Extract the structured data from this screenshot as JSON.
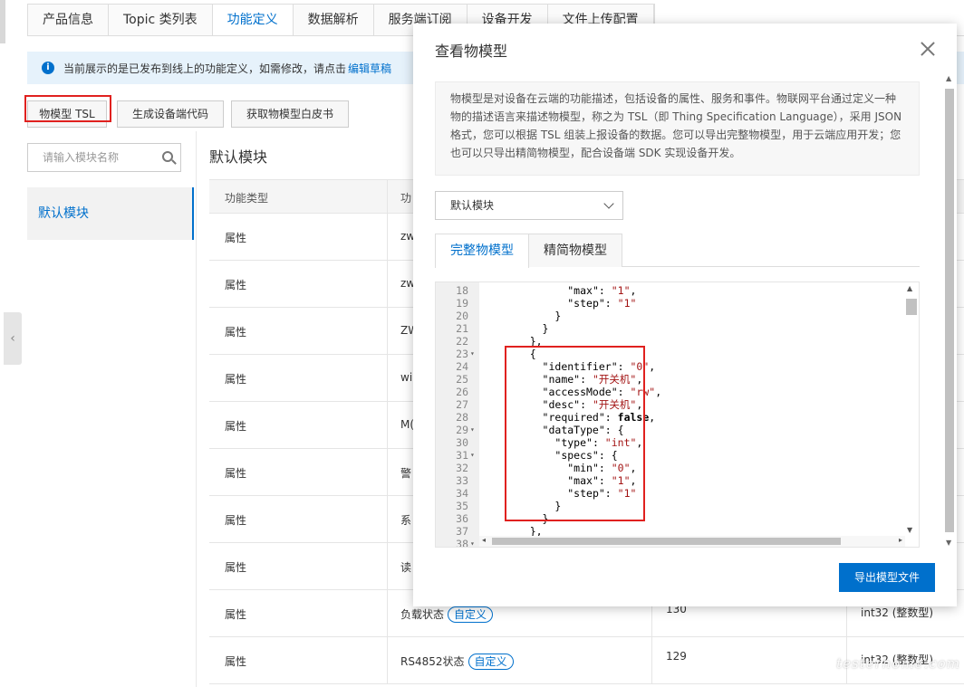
{
  "page": {
    "tabs": [
      "产品信息",
      "Topic 类列表",
      "功能定义",
      "数据解析",
      "服务端订阅",
      "设备开发",
      "文件上传配置"
    ],
    "active_tab": "功能定义",
    "notice_text": "当前展示的是已发布到线上的功能定义，如需修改，请点击",
    "notice_link": "编辑草稿",
    "buttons": {
      "tsl": "物模型 TSL",
      "gen_code": "生成设备端代码",
      "whitepaper": "获取物模型白皮书"
    },
    "search_placeholder": "请输入模块名称",
    "sidebar_module": "默认模块",
    "module_title": "默认模块",
    "table": {
      "headers": [
        "功能类型",
        "功"
      ],
      "rows": [
        {
          "type": "属性",
          "name": "zw",
          "tag": "",
          "id": "",
          "datatype": ""
        },
        {
          "type": "属性",
          "name": "zw",
          "tag": "",
          "id": "",
          "datatype": ""
        },
        {
          "type": "属性",
          "name": "ZW",
          "tag": "",
          "id": "",
          "datatype": ""
        },
        {
          "type": "属性",
          "name": "wi",
          "tag": "",
          "id": "",
          "datatype": ""
        },
        {
          "type": "属性",
          "name": "M(",
          "tag": "",
          "id": "",
          "datatype": ""
        },
        {
          "type": "属性",
          "name": "警",
          "tag": "",
          "id": "",
          "datatype": ""
        },
        {
          "type": "属性",
          "name": "系",
          "tag": "",
          "id": "",
          "datatype": ""
        },
        {
          "type": "属性",
          "name": "读",
          "tag": "",
          "id": "",
          "datatype": ""
        },
        {
          "type": "属性",
          "name": "负载状态",
          "tag": "自定义",
          "id": "130",
          "datatype": "int32 (整数型)"
        },
        {
          "type": "属性",
          "name": "RS4852状态",
          "tag": "自定义",
          "id": "129",
          "datatype": "int32 (整数型)"
        }
      ]
    }
  },
  "modal": {
    "title": "查看物模型",
    "description": "物模型是对设备在云端的功能描述，包括设备的属性、服务和事件。物联网平台通过定义一种物的描述语言来描述物模型，称之为 TSL（即 Thing Specification Language），采用 JSON 格式，您可以根据 TSL 组装上报设备的数据。您可以导出完整物模型，用于云端应用开发；您也可以只导出精简物模型，配合设备端 SDK 实现设备开发。",
    "module_select": "默认模块",
    "tabs": [
      "完整物模型",
      "精简物模型"
    ],
    "active_tab": "完整物模型",
    "export_button": "导出模型文件",
    "code_lines": [
      {
        "n": "18",
        "fold": "",
        "segs": [
          [
            "t",
            "          "
          ],
          [
            "k",
            "\"max\""
          ],
          [
            "t",
            ": "
          ],
          [
            "s",
            "\"1\""
          ],
          [
            "t",
            ","
          ]
        ]
      },
      {
        "n": "19",
        "fold": "",
        "segs": [
          [
            "t",
            "          "
          ],
          [
            "k",
            "\"step\""
          ],
          [
            "t",
            ": "
          ],
          [
            "s",
            "\"1\""
          ]
        ]
      },
      {
        "n": "20",
        "fold": "",
        "segs": [
          [
            "t",
            "        }"
          ]
        ]
      },
      {
        "n": "21",
        "fold": "",
        "segs": [
          [
            "t",
            "      }"
          ]
        ]
      },
      {
        "n": "22",
        "fold": "",
        "segs": [
          [
            "t",
            "    },"
          ]
        ]
      },
      {
        "n": "23",
        "fold": "▾",
        "segs": [
          [
            "t",
            "    {"
          ]
        ]
      },
      {
        "n": "24",
        "fold": "",
        "segs": [
          [
            "t",
            "      "
          ],
          [
            "k",
            "\"identifier\""
          ],
          [
            "t",
            ": "
          ],
          [
            "s",
            "\"0\""
          ],
          [
            "t",
            ","
          ]
        ]
      },
      {
        "n": "25",
        "fold": "",
        "segs": [
          [
            "t",
            "      "
          ],
          [
            "k",
            "\"name\""
          ],
          [
            "t",
            ": "
          ],
          [
            "s",
            "\"开关机\""
          ],
          [
            "t",
            ","
          ]
        ]
      },
      {
        "n": "26",
        "fold": "",
        "segs": [
          [
            "t",
            "      "
          ],
          [
            "k",
            "\"accessMode\""
          ],
          [
            "t",
            ": "
          ],
          [
            "s",
            "\"rw\""
          ],
          [
            "t",
            ","
          ]
        ]
      },
      {
        "n": "27",
        "fold": "",
        "segs": [
          [
            "t",
            "      "
          ],
          [
            "k",
            "\"desc\""
          ],
          [
            "t",
            ": "
          ],
          [
            "s",
            "\"开关机\""
          ],
          [
            "t",
            ","
          ]
        ]
      },
      {
        "n": "28",
        "fold": "",
        "segs": [
          [
            "t",
            "      "
          ],
          [
            "k",
            "\"required\""
          ],
          [
            "t",
            ": "
          ],
          [
            "b",
            "false"
          ],
          [
            "t",
            ","
          ]
        ]
      },
      {
        "n": "29",
        "fold": "▾",
        "segs": [
          [
            "t",
            "      "
          ],
          [
            "k",
            "\"dataType\""
          ],
          [
            "t",
            ": {"
          ]
        ]
      },
      {
        "n": "30",
        "fold": "",
        "segs": [
          [
            "t",
            "        "
          ],
          [
            "k",
            "\"type\""
          ],
          [
            "t",
            ": "
          ],
          [
            "s",
            "\"int\""
          ],
          [
            "t",
            ","
          ]
        ]
      },
      {
        "n": "31",
        "fold": "▾",
        "segs": [
          [
            "t",
            "        "
          ],
          [
            "k",
            "\"specs\""
          ],
          [
            "t",
            ": {"
          ]
        ]
      },
      {
        "n": "32",
        "fold": "",
        "segs": [
          [
            "t",
            "          "
          ],
          [
            "k",
            "\"min\""
          ],
          [
            "t",
            ": "
          ],
          [
            "s",
            "\"0\""
          ],
          [
            "t",
            ","
          ]
        ]
      },
      {
        "n": "33",
        "fold": "",
        "segs": [
          [
            "t",
            "          "
          ],
          [
            "k",
            "\"max\""
          ],
          [
            "t",
            ": "
          ],
          [
            "s",
            "\"1\""
          ],
          [
            "t",
            ","
          ]
        ]
      },
      {
        "n": "34",
        "fold": "",
        "segs": [
          [
            "t",
            "          "
          ],
          [
            "k",
            "\"step\""
          ],
          [
            "t",
            ": "
          ],
          [
            "s",
            "\"1\""
          ]
        ]
      },
      {
        "n": "35",
        "fold": "",
        "segs": [
          [
            "t",
            "        }"
          ]
        ]
      },
      {
        "n": "36",
        "fold": "",
        "segs": [
          [
            "t",
            "      }"
          ]
        ]
      },
      {
        "n": "37",
        "fold": "",
        "segs": [
          [
            "t",
            "    },"
          ]
        ]
      },
      {
        "n": "38",
        "fold": "▾",
        "segs": [
          [
            "t",
            "    {"
          ]
        ]
      }
    ]
  },
  "watermark": "testerhome.com",
  "colors": {
    "accent": "#0070cc",
    "highlight_border": "#e0211f",
    "string": "#a31515"
  }
}
